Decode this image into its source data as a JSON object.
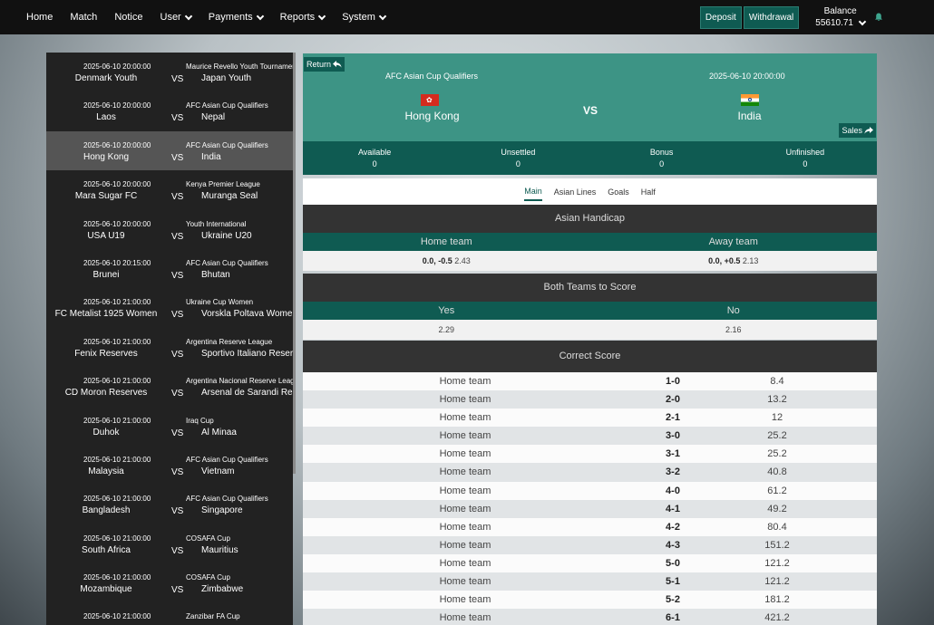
{
  "nav": {
    "home": "Home",
    "match": "Match",
    "notice": "Notice",
    "user": "User",
    "payments": "Payments",
    "reports": "Reports",
    "system": "System",
    "deposit": "Deposit",
    "withdrawal": "Withdrawal",
    "balance_label": "Balance",
    "balance_value": "55610.71"
  },
  "matches": [
    {
      "time": "2025-06-10 20:00:00",
      "home": "Denmark Youth",
      "vs": "VS",
      "league": "Maurice Revello Youth Tournament",
      "away": "Japan Youth"
    },
    {
      "time": "2025-06-10 20:00:00",
      "home": "Laos",
      "vs": "VS",
      "league": "AFC Asian Cup Qualifiers",
      "away": "Nepal"
    },
    {
      "time": "2025-06-10 20:00:00",
      "home": "Hong Kong",
      "vs": "VS",
      "league": "AFC Asian Cup Qualifiers",
      "away": "India"
    },
    {
      "time": "2025-06-10 20:00:00",
      "home": "Mara Sugar FC",
      "vs": "VS",
      "league": "Kenya Premier League",
      "away": "Muranga Seal"
    },
    {
      "time": "2025-06-10 20:00:00",
      "home": "USA U19",
      "vs": "VS",
      "league": "Youth International",
      "away": "Ukraine U20"
    },
    {
      "time": "2025-06-10 20:15:00",
      "home": "Brunei",
      "vs": "VS",
      "league": "AFC Asian Cup Qualifiers",
      "away": "Bhutan"
    },
    {
      "time": "2025-06-10 21:00:00",
      "home": "FC Metalist 1925 Women",
      "vs": "VS",
      "league": "Ukraine Cup Women",
      "away": "Vorskla Poltava Women"
    },
    {
      "time": "2025-06-10 21:00:00",
      "home": "Fenix Reserves",
      "vs": "VS",
      "league": "Argentina Reserve League",
      "away": "Sportivo Italiano Reserves"
    },
    {
      "time": "2025-06-10 21:00:00",
      "home": "CD Moron Reserves",
      "vs": "VS",
      "league": "Argentina Nacional Reserve League",
      "away": "Arsenal de Sarandi Reserves"
    },
    {
      "time": "2025-06-10 21:00:00",
      "home": "Duhok",
      "vs": "VS",
      "league": "Iraq Cup",
      "away": "Al Minaa"
    },
    {
      "time": "2025-06-10 21:00:00",
      "home": "Malaysia",
      "vs": "VS",
      "league": "AFC Asian Cup Qualifiers",
      "away": "Vietnam"
    },
    {
      "time": "2025-06-10 21:00:00",
      "home": "Bangladesh",
      "vs": "VS",
      "league": "AFC Asian Cup Qualifiers",
      "away": "Singapore"
    },
    {
      "time": "2025-06-10 21:00:00",
      "home": "South Africa",
      "vs": "VS",
      "league": "COSAFA Cup",
      "away": "Mauritius"
    },
    {
      "time": "2025-06-10 21:00:00",
      "home": "Mozambique",
      "vs": "VS",
      "league": "COSAFA Cup",
      "away": "Zimbabwe"
    },
    {
      "time": "2025-06-10 21:00:00",
      "home": "",
      "vs": "",
      "league": "Zanzibar FA Cup",
      "away": ""
    }
  ],
  "detail": {
    "return_label": "Return",
    "sales_label": "Sales",
    "league": "AFC Asian Cup Qualifiers",
    "date": "2025-06-10 20:00:00",
    "home": "Hong Kong",
    "vs": "VS",
    "away": "India",
    "stats": [
      {
        "label": "Available",
        "value": "0"
      },
      {
        "label": "Unsettled",
        "value": "0"
      },
      {
        "label": "Bonus",
        "value": "0"
      },
      {
        "label": "Unfinished",
        "value": "0"
      }
    ],
    "tabs": [
      "Main",
      "Asian Lines",
      "Goals",
      "Half"
    ],
    "active_tab": "Main"
  },
  "asian_handicap": {
    "title": "Asian Handicap",
    "home_header": "Home team",
    "away_header": "Away team",
    "home_line": "0.0, -0.5",
    "home_odds": "2.43",
    "away_line": "0.0, +0.5",
    "away_odds": "2.13"
  },
  "btts": {
    "title": "Both Teams to Score",
    "yes_header": "Yes",
    "no_header": "No",
    "yes_odds": "2.29",
    "no_odds": "2.16"
  },
  "correct_score": {
    "title": "Correct Score",
    "rows": [
      {
        "team": "Home team",
        "score": "1-0",
        "odds": "8.4"
      },
      {
        "team": "Home team",
        "score": "2-0",
        "odds": "13.2"
      },
      {
        "team": "Home team",
        "score": "2-1",
        "odds": "12"
      },
      {
        "team": "Home team",
        "score": "3-0",
        "odds": "25.2"
      },
      {
        "team": "Home team",
        "score": "3-1",
        "odds": "25.2"
      },
      {
        "team": "Home team",
        "score": "3-2",
        "odds": "40.8"
      },
      {
        "team": "Home team",
        "score": "4-0",
        "odds": "61.2"
      },
      {
        "team": "Home team",
        "score": "4-1",
        "odds": "49.2"
      },
      {
        "team": "Home team",
        "score": "4-2",
        "odds": "80.4"
      },
      {
        "team": "Home team",
        "score": "4-3",
        "odds": "151.2"
      },
      {
        "team": "Home team",
        "score": "5-0",
        "odds": "121.2"
      },
      {
        "team": "Home team",
        "score": "5-1",
        "odds": "121.2"
      },
      {
        "team": "Home team",
        "score": "5-2",
        "odds": "181.2"
      },
      {
        "team": "Home team",
        "score": "6-1",
        "odds": "421.2"
      }
    ]
  },
  "colors": {
    "accent": "#0f5b52",
    "header_bg": "#3d9485",
    "section_bg": "#333333",
    "nav_bg": "#111111"
  }
}
